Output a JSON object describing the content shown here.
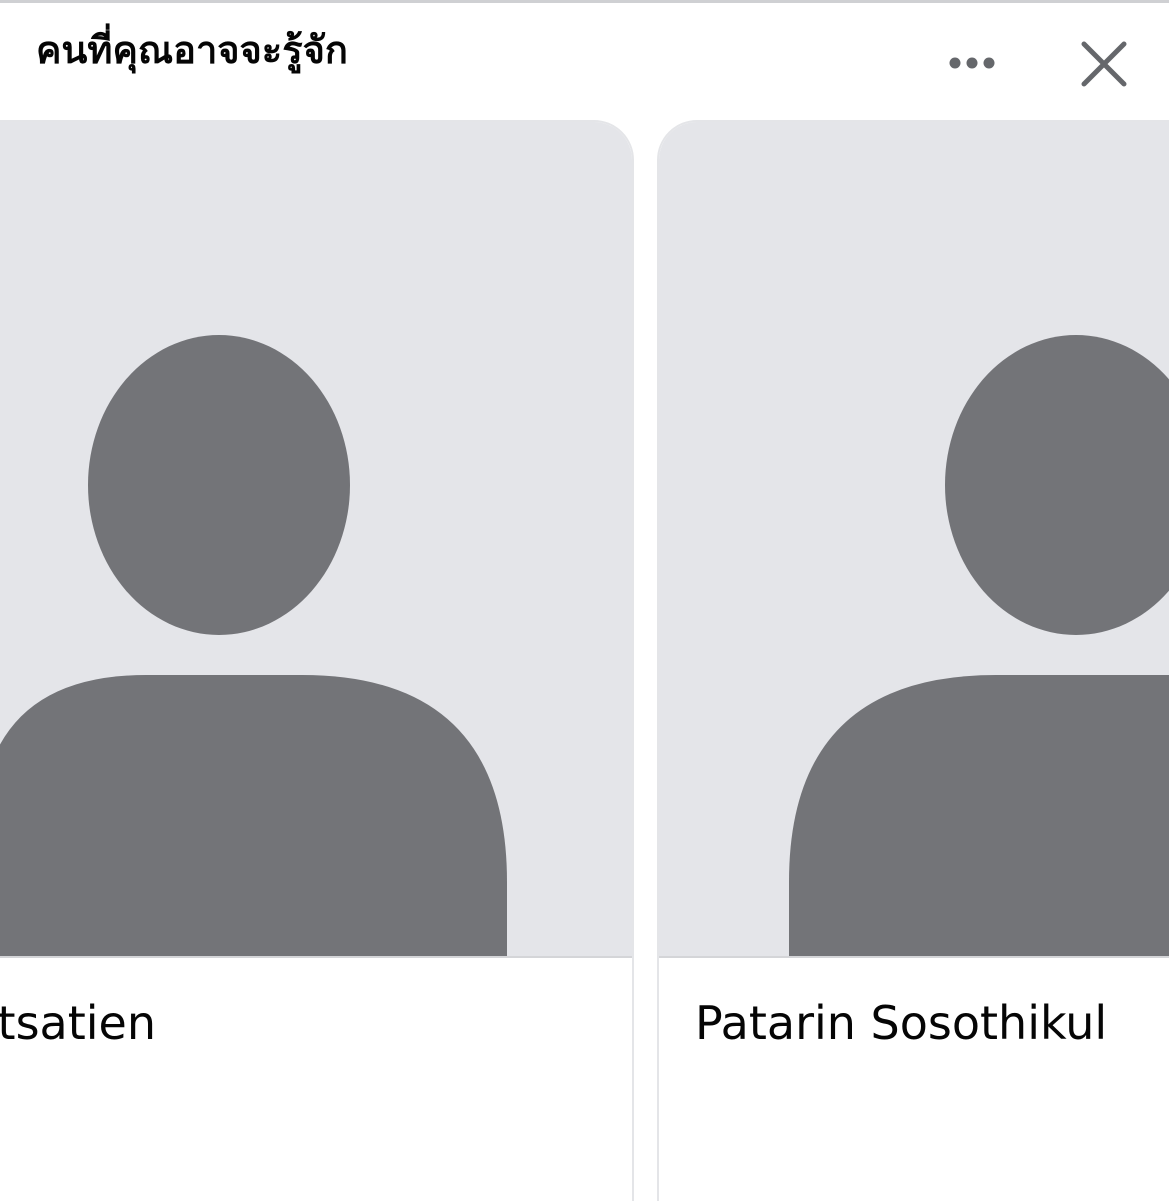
{
  "section": {
    "title": "คนที่คุณอาจจะรู้จัก"
  },
  "header_actions": {
    "more_icon": "more-horizontal-icon",
    "close_icon": "close-icon"
  },
  "cards": [
    {
      "name": "tsatien",
      "avatar_icon": "default-avatar-icon"
    },
    {
      "name": "Patarin Sosothikul",
      "avatar_icon": "default-avatar-icon"
    }
  ],
  "colors": {
    "photo_background": "#e4e5e9",
    "avatar_silhouette": "#737478",
    "text": "#050505",
    "icon": "#65676b"
  }
}
